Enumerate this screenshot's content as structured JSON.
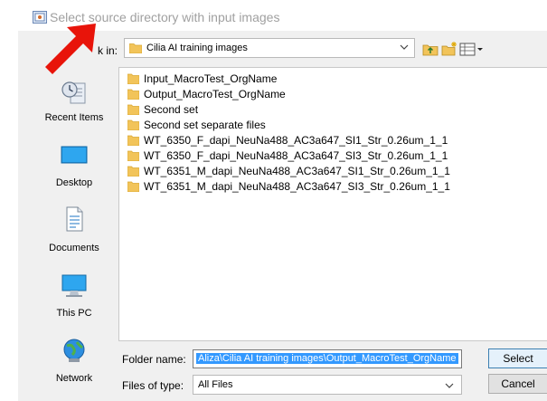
{
  "window": {
    "title": "Select source directory with input images"
  },
  "look_in": {
    "label": "k in:",
    "value": "Cilia AI training images"
  },
  "toolbar": {
    "icons": [
      "up-folder-icon",
      "new-folder-icon",
      "view-menu-icon"
    ]
  },
  "places": [
    {
      "label": "Recent Items",
      "icon": "recent-items-icon"
    },
    {
      "label": "Desktop",
      "icon": "desktop-icon"
    },
    {
      "label": "Documents",
      "icon": "documents-icon"
    },
    {
      "label": "This PC",
      "icon": "computer-icon"
    },
    {
      "label": "Network",
      "icon": "network-icon"
    }
  ],
  "files": [
    "Input_MacroTest_OrgName",
    "Output_MacroTest_OrgName",
    "Second set",
    "Second set separate files",
    "WT_6350_F_dapi_NeuNa488_AC3a647_SI1_Str_0.26um_1_1",
    "WT_6350_F_dapi_NeuNa488_AC3a647_SI3_Str_0.26um_1_1",
    "WT_6351_M_dapi_NeuNa488_AC3a647_SI1_Str_0.26um_1_1",
    "WT_6351_M_dapi_NeuNa488_AC3a647_SI3_Str_0.26um_1_1"
  ],
  "folder_name": {
    "label": "Folder name:",
    "value": "Aliza\\Cilia AI training images\\Output_MacroTest_OrgName"
  },
  "files_of_type": {
    "label": "Files of type:",
    "value": "All Files"
  },
  "buttons": {
    "select": "Select",
    "cancel": "Cancel"
  },
  "colors": {
    "folder": "#f2c45a",
    "selection": "#3399ff",
    "arrow": "#e8140a"
  }
}
